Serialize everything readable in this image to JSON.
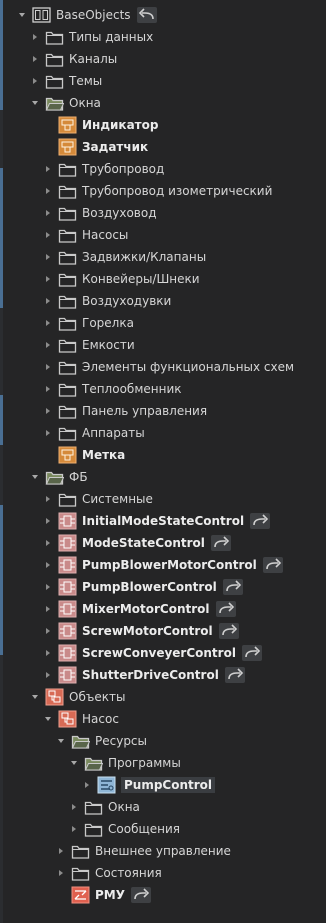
{
  "tree": [
    {
      "label": "BaseObjects",
      "icon": "module-icon",
      "toggle": "open",
      "level": 0,
      "bold": false,
      "link": "back"
    },
    {
      "label": "Типы данных",
      "icon": "folder-icon",
      "toggle": "closed",
      "level": 1
    },
    {
      "label": "Каналы",
      "icon": "folder-icon",
      "toggle": "closed",
      "level": 1
    },
    {
      "label": "Темы",
      "icon": "folder-icon",
      "toggle": "closed",
      "level": 1
    },
    {
      "label": "Окна",
      "icon": "folder-open-icon",
      "toggle": "open",
      "level": 1
    },
    {
      "label": "Индикатор",
      "icon": "window-icon",
      "toggle": "none",
      "level": 2,
      "bold": true
    },
    {
      "label": "Задатчик",
      "icon": "window-icon",
      "toggle": "none",
      "level": 2,
      "bold": true
    },
    {
      "label": "Трубопровод",
      "icon": "folder-icon",
      "toggle": "closed",
      "level": 2
    },
    {
      "label": "Трубопровод изометрический",
      "icon": "folder-icon",
      "toggle": "closed",
      "level": 2
    },
    {
      "label": "Воздуховод",
      "icon": "folder-icon",
      "toggle": "closed",
      "level": 2
    },
    {
      "label": "Насосы",
      "icon": "folder-icon",
      "toggle": "closed",
      "level": 2
    },
    {
      "label": "Задвижки/Клапаны",
      "icon": "folder-icon",
      "toggle": "closed",
      "level": 2
    },
    {
      "label": "Конвейеры/Шнеки",
      "icon": "folder-icon",
      "toggle": "closed",
      "level": 2
    },
    {
      "label": "Воздуходувки",
      "icon": "folder-icon",
      "toggle": "closed",
      "level": 2
    },
    {
      "label": "Горелка",
      "icon": "folder-icon",
      "toggle": "closed",
      "level": 2
    },
    {
      "label": "Емкости",
      "icon": "folder-icon",
      "toggle": "closed",
      "level": 2
    },
    {
      "label": "Элементы функциональных схем",
      "icon": "folder-icon",
      "toggle": "closed",
      "level": 2
    },
    {
      "label": "Теплообменник",
      "icon": "folder-icon",
      "toggle": "closed",
      "level": 2
    },
    {
      "label": "Панель управления",
      "icon": "folder-icon",
      "toggle": "closed",
      "level": 2
    },
    {
      "label": "Аппараты",
      "icon": "folder-icon",
      "toggle": "closed",
      "level": 2
    },
    {
      "label": "Метка",
      "icon": "window-icon",
      "toggle": "none",
      "level": 2,
      "bold": true
    },
    {
      "label": "ФБ",
      "icon": "folder-open-icon",
      "toggle": "open",
      "level": 1
    },
    {
      "label": "Системные",
      "icon": "folder-icon",
      "toggle": "closed",
      "level": 2
    },
    {
      "label": "InitialModeStateControl",
      "icon": "fb-icon",
      "toggle": "closed",
      "level": 2,
      "bold": true,
      "link": "forward"
    },
    {
      "label": "ModeStateControl",
      "icon": "fb-icon",
      "toggle": "closed",
      "level": 2,
      "bold": true,
      "link": "forward"
    },
    {
      "label": "PumpBlowerMotorControl",
      "icon": "fb-icon",
      "toggle": "closed",
      "level": 2,
      "bold": true,
      "link": "forward"
    },
    {
      "label": "PumpBlowerControl",
      "icon": "fb-icon",
      "toggle": "closed",
      "level": 2,
      "bold": true,
      "link": "forward"
    },
    {
      "label": "MixerMotorControl",
      "icon": "fb-icon",
      "toggle": "closed",
      "level": 2,
      "bold": true,
      "link": "forward"
    },
    {
      "label": "ScrewMotorControl",
      "icon": "fb-icon",
      "toggle": "closed",
      "level": 2,
      "bold": true,
      "link": "forward"
    },
    {
      "label": "ScrewConveyerControl",
      "icon": "fb-icon",
      "toggle": "closed",
      "level": 2,
      "bold": true,
      "link": "forward"
    },
    {
      "label": "ShutterDriveControl",
      "icon": "fb-icon",
      "toggle": "closed",
      "level": 2,
      "bold": true,
      "link": "forward"
    },
    {
      "label": "Объекты",
      "icon": "object-icon",
      "toggle": "open",
      "level": 1
    },
    {
      "label": "Насос",
      "icon": "object-icon",
      "toggle": "open",
      "level": 2
    },
    {
      "label": "Ресурсы",
      "icon": "folder-open-icon",
      "toggle": "open",
      "level": 3
    },
    {
      "label": "Программы",
      "icon": "folder-open-icon",
      "toggle": "open",
      "level": 4
    },
    {
      "label": "PumpControl",
      "icon": "program-icon",
      "toggle": "closed",
      "level": 5,
      "bold": true,
      "selected": true
    },
    {
      "label": "Окна",
      "icon": "folder-icon",
      "toggle": "closed",
      "level": 4
    },
    {
      "label": "Сообщения",
      "icon": "folder-icon",
      "toggle": "closed",
      "level": 4
    },
    {
      "label": "Внешнее управление",
      "icon": "folder-icon",
      "toggle": "closed",
      "level": 3
    },
    {
      "label": "Состояния",
      "icon": "folder-icon",
      "toggle": "closed",
      "level": 3
    },
    {
      "label": "РМУ",
      "icon": "rmu-icon",
      "toggle": "none",
      "level": 3,
      "bold": true,
      "link": "forward"
    }
  ],
  "colors": {
    "background": "#252526",
    "text": "#d6d6d6",
    "folder_outline": "#c9c9c9",
    "folder_open_fill": "#7a8a5e",
    "window_icon": "#d58a3a",
    "fb_icon": "#c98a8a",
    "object_icon": "#d76a55",
    "program_icon": "#8fb6d6",
    "rmu_icon": "#e0604f",
    "link_bg": "#3e4043",
    "selection": "#3a3d41"
  }
}
